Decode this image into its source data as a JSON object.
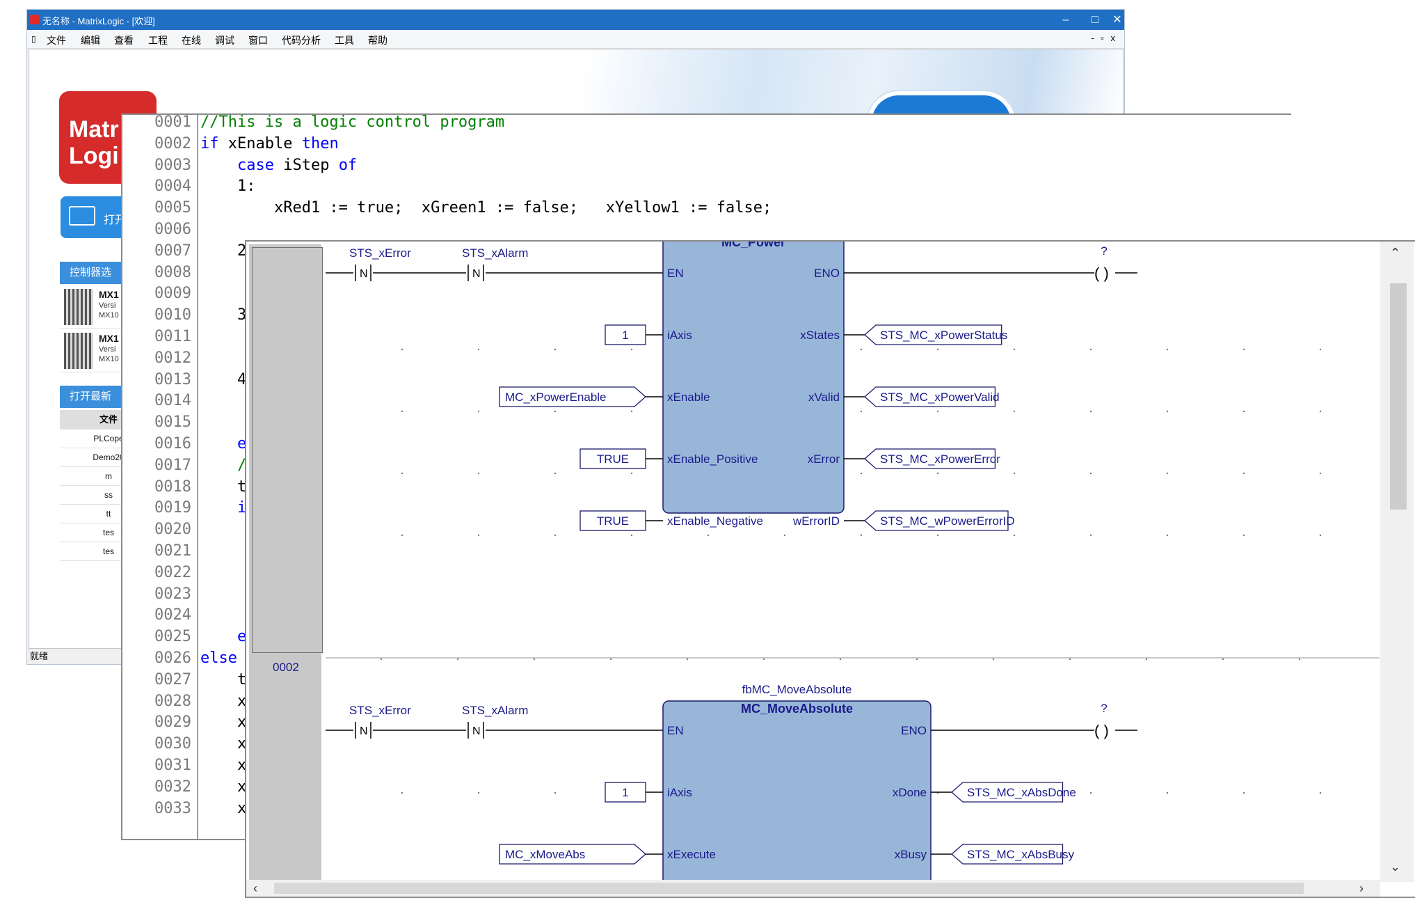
{
  "window": {
    "title": "无名称 - MatrixLogic - [欢迎]",
    "controls": [
      "–",
      "□",
      "✕"
    ],
    "mdi_controls": "- ▫ x"
  },
  "menu": [
    "文件",
    "编辑",
    "查看",
    "工程",
    "在线",
    "调试",
    "窗口",
    "代码分析",
    "工具",
    "帮助"
  ],
  "start_page": {
    "logo_text": [
      "Matr",
      "Logi"
    ],
    "open_button_label": "打开",
    "controller_header": "控制器选",
    "controllers": [
      {
        "name": "MX1",
        "version": "Versi",
        "model": "MX10"
      },
      {
        "name": "MX1",
        "version": "Versi",
        "model": "MX10"
      }
    ],
    "recent_header": "打开最新",
    "files_column": "文件",
    "files": [
      "PLCope",
      "Demo20",
      "m",
      "ss",
      "tt",
      "tes",
      "tes"
    ],
    "status": "就绪"
  },
  "st_editor": {
    "lines": [
      {
        "n": "0001",
        "segs": [
          [
            "cm",
            "//This is a logic control program"
          ]
        ]
      },
      {
        "n": "0002",
        "segs": [
          [
            "kw",
            "if"
          ],
          [
            "",
            " xEnable "
          ],
          [
            "kw",
            "then"
          ]
        ]
      },
      {
        "n": "0003",
        "segs": [
          [
            "",
            "    "
          ],
          [
            "kw",
            "case"
          ],
          [
            "",
            " iStep "
          ],
          [
            "kw",
            "of"
          ]
        ]
      },
      {
        "n": "0004",
        "segs": [
          [
            "",
            "    1:"
          ]
        ]
      },
      {
        "n": "0005",
        "segs": [
          [
            "",
            "        xRed1 := true;  xGreen1 := false;   xYellow1 := false;"
          ]
        ]
      },
      {
        "n": "0006",
        "segs": []
      },
      {
        "n": "0007",
        "segs": [
          [
            "",
            "    2"
          ]
        ]
      },
      {
        "n": "0008",
        "segs": []
      },
      {
        "n": "0009",
        "segs": []
      },
      {
        "n": "0010",
        "segs": [
          [
            "",
            "    3"
          ]
        ]
      },
      {
        "n": "0011",
        "segs": []
      },
      {
        "n": "0012",
        "segs": []
      },
      {
        "n": "0013",
        "segs": [
          [
            "",
            "    4"
          ]
        ]
      },
      {
        "n": "0014",
        "segs": []
      },
      {
        "n": "0015",
        "segs": []
      },
      {
        "n": "0016",
        "segs": [
          [
            "kw",
            "    e"
          ]
        ]
      },
      {
        "n": "0017",
        "segs": [
          [
            "cm",
            "    /"
          ]
        ]
      },
      {
        "n": "0018",
        "segs": [
          [
            "",
            "    t"
          ]
        ]
      },
      {
        "n": "0019",
        "segs": [
          [
            "kw",
            "    i"
          ]
        ]
      },
      {
        "n": "0020",
        "segs": []
      },
      {
        "n": "0021",
        "segs": []
      },
      {
        "n": "0022",
        "segs": []
      },
      {
        "n": "0023",
        "segs": []
      },
      {
        "n": "0024",
        "segs": []
      },
      {
        "n": "0025",
        "segs": [
          [
            "kw",
            "    e"
          ]
        ]
      },
      {
        "n": "0026",
        "segs": [
          [
            "kw",
            "else"
          ],
          [
            "",
            " "
          ]
        ]
      },
      {
        "n": "0027",
        "segs": [
          [
            "",
            "    t"
          ]
        ]
      },
      {
        "n": "0028",
        "segs": [
          [
            "",
            "    x"
          ]
        ]
      },
      {
        "n": "0029",
        "segs": [
          [
            "",
            "    x"
          ]
        ]
      },
      {
        "n": "0030",
        "segs": [
          [
            "",
            "    x"
          ]
        ]
      },
      {
        "n": "0031",
        "segs": [
          [
            "",
            "    x"
          ]
        ]
      },
      {
        "n": "0032",
        "segs": [
          [
            "",
            "    x"
          ]
        ]
      },
      {
        "n": "0033",
        "segs": [
          [
            "",
            "    x"
          ]
        ]
      }
    ]
  },
  "fbd_editor": {
    "network2_number": "0002",
    "networks": [
      {
        "contacts": [
          {
            "name": "STS_xError",
            "type": "N"
          },
          {
            "name": "STS_xAlarm",
            "type": "N"
          }
        ],
        "block": {
          "instance": "",
          "type": "MC_Power",
          "inputs": [
            "EN",
            "iAxis",
            "xEnable",
            "xEnable_Positive",
            "xEnable_Negative"
          ],
          "outputs": [
            "ENO",
            "xStates",
            "xValid",
            "xError",
            "wErrorID"
          ]
        },
        "input_values": [
          "1",
          "MC_xPowerEnable",
          "TRUE",
          "TRUE"
        ],
        "output_vars": [
          "STS_MC_xPowerStatus",
          "STS_MC_xPowerValid",
          "STS_MC_xPowerError",
          "STS_MC_wPowerErrorID"
        ],
        "coil": "?"
      },
      {
        "contacts": [
          {
            "name": "STS_xError",
            "type": "N"
          },
          {
            "name": "STS_xAlarm",
            "type": "N"
          }
        ],
        "block": {
          "instance": "fbMC_MoveAbsolute",
          "type": "MC_MoveAbsolute",
          "inputs": [
            "EN",
            "iAxis",
            "xExecute"
          ],
          "outputs": [
            "ENO",
            "xDone",
            "xBusy"
          ]
        },
        "input_values": [
          "1",
          "MC_xMoveAbs"
        ],
        "output_vars": [
          "STS_MC_xAbsDone",
          "STS_MC_xAbsBusy"
        ],
        "coil": "?"
      }
    ]
  },
  "colors": {
    "titlebar": "#1f6fc5",
    "brand_red": "#d52b2b",
    "fb_fill": "#98b6d8",
    "fb_border": "#1a1a6e",
    "wire": "#000000",
    "label_blue": "#1a1a8a",
    "keyword": "#0000ff",
    "comment": "#008000",
    "line_number": "#7a7a7a"
  }
}
